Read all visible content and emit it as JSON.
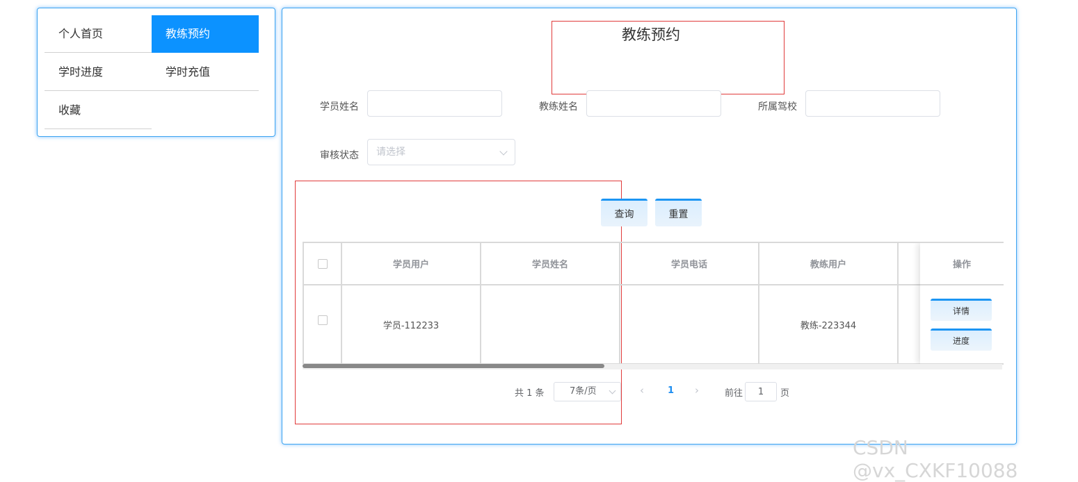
{
  "sidebar": {
    "items": [
      {
        "label": "个人首页",
        "active": false
      },
      {
        "label": "教练预约",
        "active": true
      },
      {
        "label": "学时进度",
        "active": false
      },
      {
        "label": "学时充值",
        "active": false
      },
      {
        "label": "收藏",
        "active": false
      }
    ]
  },
  "page": {
    "title": "教练预约"
  },
  "filters": {
    "student_name_label": "学员姓名",
    "student_name_value": "",
    "coach_name_label": "教练姓名",
    "coach_name_value": "",
    "school_label": "所属驾校",
    "school_value": "",
    "status_label": "审核状态",
    "status_placeholder": "请选择"
  },
  "actions": {
    "query_label": "查询",
    "reset_label": "重置"
  },
  "table": {
    "headers": [
      "学员用户",
      "学员姓名",
      "学员电话",
      "教练用户",
      "操作"
    ],
    "rows": [
      {
        "student_user": "学员-112233",
        "student_name": "",
        "student_phone": "",
        "coach_user": "教练-223344",
        "detail_label": "详情",
        "progress_label": "进度"
      }
    ]
  },
  "pagination": {
    "total_text": "共 1 条",
    "page_size": "7条/页",
    "current_page": "1",
    "goto_prefix": "前往",
    "goto_value": "1",
    "goto_suffix": "页"
  },
  "watermark": "CSDN @vx_CXKF10088",
  "colors": {
    "accent": "#0c92ff",
    "panel_border": "#3da4f0",
    "annotation_red": "#e03a3a"
  }
}
